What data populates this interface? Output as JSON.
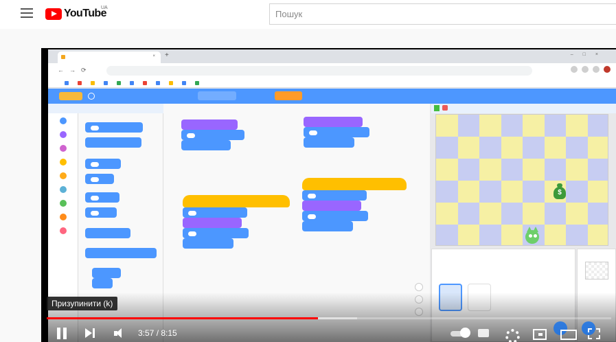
{
  "header": {
    "brand": "YouTube",
    "region": "UA",
    "search_placeholder": "Пошук"
  },
  "player": {
    "tooltip": "Призупинити (k)",
    "current_time": "3:57",
    "duration": "8:15",
    "progress_fraction": 0.48,
    "buffered_fraction": 0.55
  },
  "icons": {
    "menu": "hamburger-icon",
    "logo": "youtube-logo-icon",
    "pause": "pause-icon",
    "next": "next-icon",
    "volume": "volume-icon",
    "autoplay": "autoplay-toggle-icon",
    "subtitles": "subtitles-icon",
    "settings": "gear-icon",
    "miniplayer": "miniplayer-icon",
    "theater": "theater-mode-icon",
    "fullscreen": "fullscreen-icon"
  },
  "colors": {
    "youtube_red": "#ff0000",
    "scratch_blue": "#4d97ff",
    "scratch_motion": "#4c97ff",
    "scratch_looks": "#9966ff",
    "scratch_events": "#ffbf00",
    "stage_yellow": "#f6f0a4",
    "stage_blue": "#c7cdf2"
  }
}
